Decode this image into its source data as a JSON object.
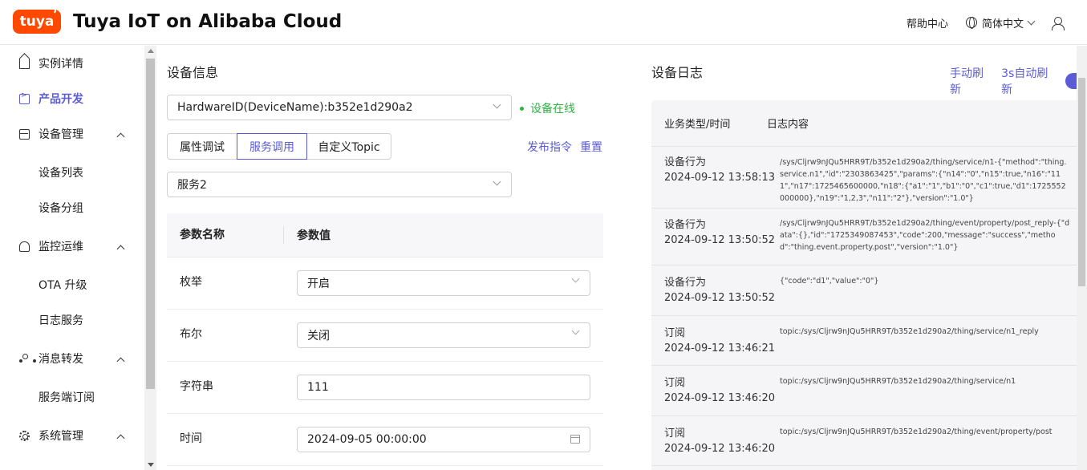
{
  "header": {
    "logo_text": "tuya",
    "title": "Tuya IoT on Alibaba Cloud",
    "help": "帮助中心",
    "language": "简体中文"
  },
  "sidebar": {
    "items": [
      {
        "label": "实例详情",
        "icon": "home-icon"
      },
      {
        "label": "产品开发",
        "icon": "code-icon",
        "active": true
      },
      {
        "label": "设备管理",
        "icon": "device-icon",
        "expanded": true
      },
      {
        "label": "设备列表",
        "sub": true
      },
      {
        "label": "设备分组",
        "sub": true
      },
      {
        "label": "监控运维",
        "icon": "monitor-icon",
        "expanded": true
      },
      {
        "label": "OTA 升级",
        "sub": true
      },
      {
        "label": "日志服务",
        "sub": true
      },
      {
        "label": "消息转发",
        "icon": "message-icon",
        "expanded": true
      },
      {
        "label": "服务端订阅",
        "sub": true
      },
      {
        "label": "系统管理",
        "icon": "gear-icon",
        "expanded": true
      }
    ]
  },
  "device": {
    "section_title": "设备信息",
    "device_select": "HardwareID(DeviceName):b352e1d290a2",
    "status": "设备在线",
    "tabs": [
      "属性调试",
      "服务调用",
      "自定义Topic"
    ],
    "active_tab": 1,
    "publish": "发布指令",
    "reset": "重置",
    "service_select": "服务2",
    "table": {
      "col_name": "参数名称",
      "col_value": "参数值",
      "rows": [
        {
          "name": "枚举",
          "value": "开启",
          "kind": "select"
        },
        {
          "name": "布尔",
          "value": "关闭",
          "kind": "select"
        },
        {
          "name": "字符串",
          "value": "111",
          "kind": "text"
        },
        {
          "name": "时间",
          "value": "2024-09-05 00:00:00",
          "kind": "date"
        }
      ]
    }
  },
  "log": {
    "title": "设备日志",
    "manual_refresh": "手动刷新",
    "auto_refresh": "3s自动刷新",
    "col_type": "业务类型/时间",
    "col_content": "日志内容",
    "rows": [
      {
        "type": "设备行为",
        "time": "2024-09-12 13:58:13",
        "content": "/sys/Cljrw9nJQu5HRR9T/b352e1d290a2/thing/service/n1-{\"method\":\"thing.service.n1\",\"id\":\"2303863425\",\"params\":{\"n14\":\"0\",\"n15\":true,\"n16\":\"111\",\"n17\":1725465600000,\"n18\":{\"a1\":\"1\",\"b1\":\"0\",\"c1\":true,\"d1\":1725552000000},\"n19\":\"1,2,3\",\"n11\":\"2\"},\"version\":\"1.0\"}"
      },
      {
        "type": "设备行为",
        "time": "2024-09-12 13:50:52",
        "content": "/sys/Cljrw9nJQu5HRR9T/b352e1d290a2/thing/event/property/post_reply-{\"data\":{},\"id\":\"1725349087453\",\"code\":200,\"message\":\"success\",\"method\":\"thing.event.property.post\",\"version\":\"1.0\"}"
      },
      {
        "type": "设备行为",
        "time": "2024-09-12 13:50:52",
        "content": "{\"code\":\"d1\",\"value\":\"0\"}"
      },
      {
        "type": "订阅",
        "time": "2024-09-12 13:46:21",
        "content": "topic:/sys/Cljrw9nJQu5HRR9T/b352e1d290a2/thing/service/n1_reply"
      },
      {
        "type": "订阅",
        "time": "2024-09-12 13:46:20",
        "content": "topic:/sys/Cljrw9nJQu5HRR9T/b352e1d290a2/thing/service/n1"
      },
      {
        "type": "订阅",
        "time": "2024-09-12 13:46:20",
        "content": "topic:/sys/Cljrw9nJQu5HRR9T/b352e1d290a2/thing/event/property/post"
      }
    ]
  }
}
